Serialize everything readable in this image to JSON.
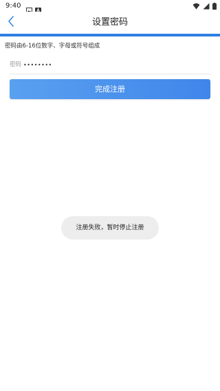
{
  "status_bar": {
    "time": "9:40"
  },
  "header": {
    "title": "设置密码"
  },
  "form": {
    "hint": "密码由6-16位数字、字母或符号组成",
    "password_label": "密码",
    "password_value": "••••••••"
  },
  "actions": {
    "submit_label": "完成注册"
  },
  "toast": {
    "message": "注册失败，暂时停止注册"
  },
  "colors": {
    "accent": "#2f7fe0",
    "button_start": "#5aa0f0",
    "button_end": "#3f86ea",
    "toast_bg": "#ededed"
  }
}
